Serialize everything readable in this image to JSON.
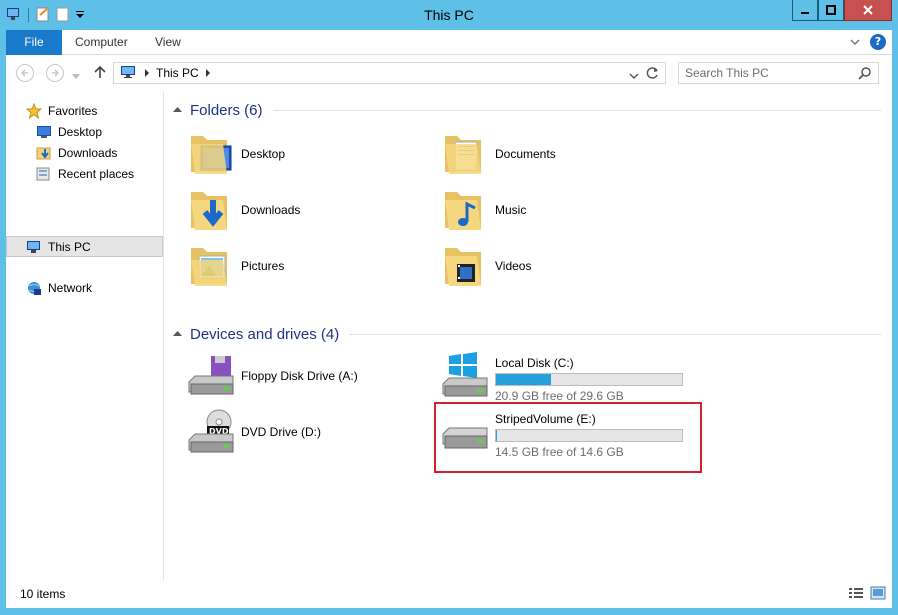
{
  "window": {
    "title": "This PC"
  },
  "ribbon": {
    "tabs": [
      "File",
      "Computer",
      "View"
    ]
  },
  "address": {
    "path": "This PC"
  },
  "search": {
    "placeholder": "Search This PC"
  },
  "nav": {
    "favorites": "Favorites",
    "favorite_items": [
      "Desktop",
      "Downloads",
      "Recent places"
    ],
    "this_pc": "This PC",
    "network": "Network"
  },
  "folders": {
    "header": "Folders (6)",
    "items": [
      "Desktop",
      "Documents",
      "Downloads",
      "Music",
      "Pictures",
      "Videos"
    ]
  },
  "devices": {
    "header": "Devices and drives (4)",
    "floppy": "Floppy Disk Drive (A:)",
    "dvd": "DVD Drive (D:)",
    "local_disk": {
      "name": "Local Disk (C:)",
      "free_text": "20.9 GB free of 29.6 GB",
      "used_fraction": 0.294
    },
    "striped": {
      "name": "StripedVolume (E:)",
      "free_text": "14.5 GB free of 14.6 GB",
      "used_fraction": 0.007
    }
  },
  "status": {
    "count": "10 items"
  },
  "colors": {
    "accent": "#1979ca",
    "highlight": "#d41e2b",
    "bar": "#26a0da"
  }
}
